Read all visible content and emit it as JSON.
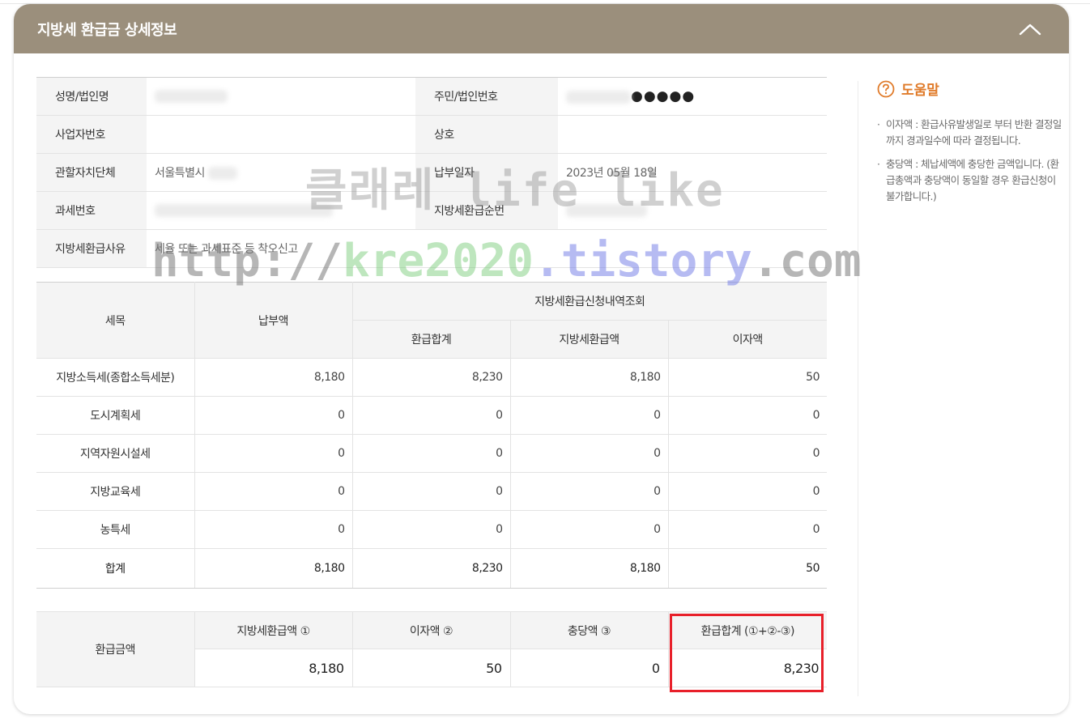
{
  "panel": {
    "title": "지방세 환급금 상세정보"
  },
  "info": {
    "name_label": "성명/법인명",
    "id_label": "주민/법인번호",
    "id_masked": "●●●●●",
    "bizno_label": "사업자번호",
    "trade_label": "상호",
    "authority_label": "관할자치단체",
    "authority_value": "서울특별시",
    "paydate_label": "납부일자",
    "paydate_value": "2023년 05월 18일",
    "taxno_label": "과세번호",
    "seq_label": "지방세환급순번",
    "reason_label": "지방세환급사유",
    "reason_value": "세율 또는 과세표준 등 착오신고"
  },
  "detail": {
    "col_item": "세목",
    "col_paid": "납부액",
    "col_group": "지방세환급신청내역조회",
    "col_refund_total": "환급합계",
    "col_refund_local": "지방세환급액",
    "col_interest": "이자액",
    "rows": [
      {
        "item": "지방소득세(종합소득세분)",
        "paid": "8,180",
        "refund_total": "8,230",
        "refund_local": "8,180",
        "interest": "50"
      },
      {
        "item": "도시계획세",
        "paid": "0",
        "refund_total": "0",
        "refund_local": "0",
        "interest": "0"
      },
      {
        "item": "지역자원시설세",
        "paid": "0",
        "refund_total": "0",
        "refund_local": "0",
        "interest": "0"
      },
      {
        "item": "지방교육세",
        "paid": "0",
        "refund_total": "0",
        "refund_local": "0",
        "interest": "0"
      },
      {
        "item": "농특세",
        "paid": "0",
        "refund_total": "0",
        "refund_local": "0",
        "interest": "0"
      }
    ],
    "total": {
      "item": "합계",
      "paid": "8,180",
      "refund_total": "8,230",
      "refund_local": "8,180",
      "interest": "50"
    }
  },
  "refund": {
    "label": "환급금액",
    "col_local": "지방세환급액 ①",
    "col_interest": "이자액 ②",
    "col_offset": "충당액 ③",
    "col_total": "환급합계 (①+②-③)",
    "local": "8,180",
    "interest": "50",
    "offset": "0",
    "total": "8,230"
  },
  "help": {
    "title": "도움말",
    "items": [
      "이자액 : 환급사유발생일로 부터 반환 결정일까지 경과일수에 따라 결정됩니다.",
      "충당액 : 체납세액에 충당한 금액입니다. (환급총액과 충당액이 동일할 경우 환급신청이 불가합니다.)"
    ]
  },
  "watermark": {
    "line1": "클래레 life like",
    "line2_a": "http://",
    "line2_b": "kre2020",
    "line2_c": ".tistory",
    "line2_d": ".com"
  },
  "colors": {
    "header_bg": "#9b8f7c",
    "help_accent": "#e07b2a",
    "highlight": "#e8202a"
  }
}
